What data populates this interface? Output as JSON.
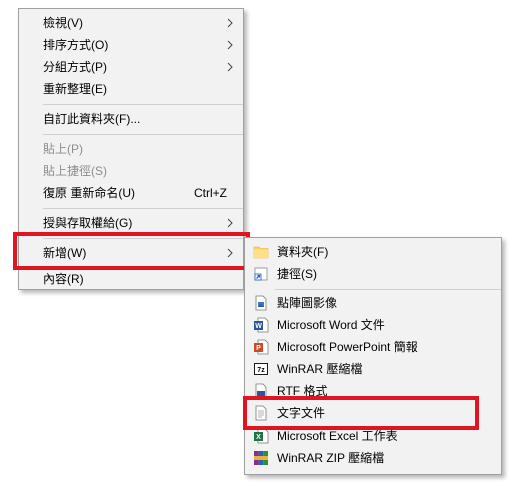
{
  "context_menu": {
    "items": [
      {
        "label": "檢視(V)",
        "has_submenu": true
      },
      {
        "label": "排序方式(O)",
        "has_submenu": true
      },
      {
        "label": "分組方式(P)",
        "has_submenu": true
      },
      {
        "label": "重新整理(E)"
      },
      {
        "label": "自訂此資料夾(F)..."
      },
      {
        "label": "貼上(P)",
        "disabled": true
      },
      {
        "label": "貼上捷徑(S)",
        "disabled": true
      },
      {
        "label": "復原 重新命名(U)",
        "shortcut": "Ctrl+Z"
      },
      {
        "label": "授與存取權給(G)",
        "has_submenu": true
      },
      {
        "label": "新增(W)",
        "has_submenu": true,
        "highlighted": true
      },
      {
        "label": "內容(R)"
      }
    ]
  },
  "new_submenu": {
    "items": [
      {
        "label": "資料夾(F)",
        "icon": "folder-icon"
      },
      {
        "label": "捷徑(S)",
        "icon": "shortcut-icon"
      },
      {
        "label": "點陣圖影像",
        "icon": "bitmap-image-icon"
      },
      {
        "label": "Microsoft Word 文件",
        "icon": "word-document-icon"
      },
      {
        "label": "Microsoft PowerPoint 簡報",
        "icon": "powerpoint-icon"
      },
      {
        "label": "WinRAR 壓縮檔",
        "icon": "winrar-archive-icon"
      },
      {
        "label": "RTF 格式",
        "icon": "rtf-document-icon"
      },
      {
        "label": "文字文件",
        "icon": "text-document-icon",
        "highlighted": true
      },
      {
        "label": "Microsoft Excel 工作表",
        "icon": "excel-icon"
      },
      {
        "label": "WinRAR ZIP 壓縮檔",
        "icon": "winrar-zip-icon"
      }
    ]
  },
  "colors": {
    "menu_background": "#f2f2f2",
    "highlight_border": "#e0151f",
    "disabled_text": "#8d8d8d"
  }
}
